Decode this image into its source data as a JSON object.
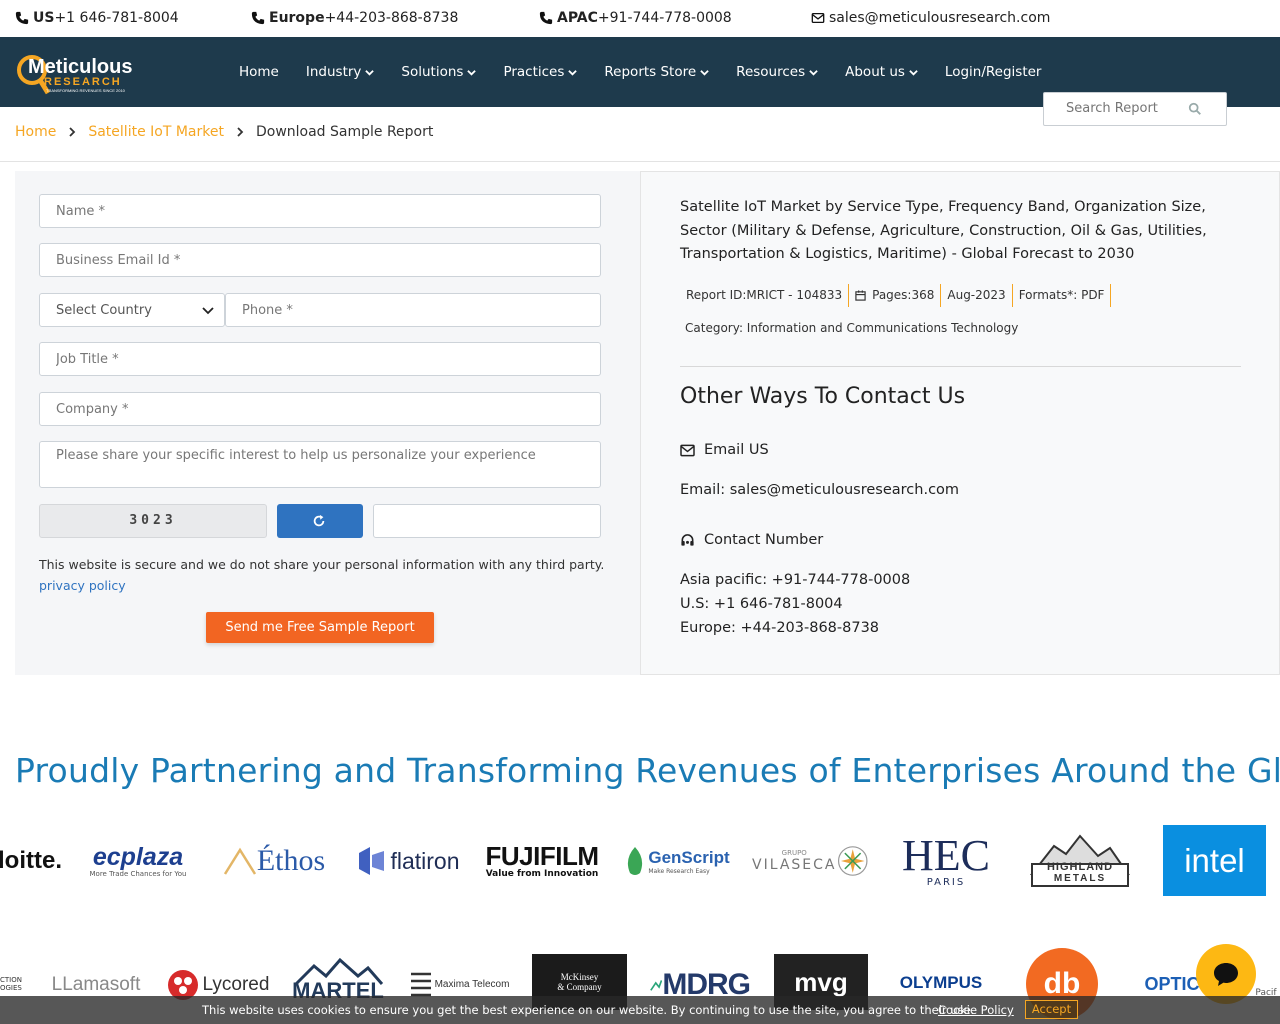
{
  "topbar": {
    "us_label": "US",
    "us_phone": "+1 646-781-8004",
    "europe_label": "Europe",
    "europe_phone": "+44-203-868-8738",
    "apac_label": "APAC",
    "apac_phone": "+91-744-778-0008",
    "email": "sales@meticulousresearch.com"
  },
  "brand": {
    "logo_name": "Meticulous",
    "logo_sub": "RESEARCH",
    "logo_tag": "TRANSFORMING REVENUES SINCE 2010",
    "colors": {
      "nav_bg": "#1e3a4c",
      "accent": "#f5a623",
      "cta": "#f26522",
      "link": "#2f73c0",
      "heading": "#1a7bb5"
    }
  },
  "nav": {
    "items": [
      {
        "label": "Home",
        "dropdown": false
      },
      {
        "label": "Industry",
        "dropdown": true
      },
      {
        "label": "Solutions",
        "dropdown": true
      },
      {
        "label": "Practices",
        "dropdown": true
      },
      {
        "label": "Reports Store",
        "dropdown": true
      },
      {
        "label": "Resources",
        "dropdown": true
      },
      {
        "label": "About us",
        "dropdown": true
      },
      {
        "label": "Login/Register",
        "dropdown": false
      }
    ],
    "search_placeholder": "Search Report"
  },
  "breadcrumb": {
    "home": "Home",
    "market": "Satellite IoT Market",
    "current": "Download Sample Report"
  },
  "form": {
    "name_placeholder": "Name *",
    "email_placeholder": "Business Email Id *",
    "country_selected": "Select Country",
    "phone_placeholder": "Phone *",
    "job_placeholder": "Job Title *",
    "company_placeholder": "Company *",
    "interest_placeholder": "Please share your specific interest to help us personalize your experience",
    "captcha_code": "3023",
    "captcha_value": "",
    "secure_note": "This website is secure and we do not share your personal information with any third party.",
    "privacy_label": "privacy policy",
    "submit_label": "Send me Free Sample Report"
  },
  "report": {
    "title": "Satellite IoT Market by Service Type, Frequency Band, Organization Size, Sector (Military & Defense, Agriculture, Construction, Oil & Gas, Utilities, Transportation & Logistics, Maritime) - Global Forecast to 2030",
    "report_id": "Report ID:MRICT - 104833",
    "pages": "Pages:368",
    "date": "Aug-2023",
    "formats": "Formats*: PDF",
    "category": "Category: Information and Communications Technology"
  },
  "contact": {
    "heading": "Other Ways To Contact Us",
    "email_heading": "Email US",
    "email_line": "Email: sales@meticulousresearch.com",
    "number_heading": "Contact Number",
    "asia": "Asia pacific: +91-744-778-0008",
    "us": "U.S: +1 646-781-8004",
    "europe": "Europe: +44-203-868-8738"
  },
  "partners": {
    "title": "Proudly Partnering and Transforming Revenues of Enterprises Around the Globe",
    "row1": [
      "loitte.",
      "ecplaza",
      "More Trade Chances for You",
      "Éthos",
      "flatiron",
      "FUJIFILM",
      "Value from Innovation",
      "GenScript",
      "Make Research Easy",
      "GRUPO",
      "VILASECA",
      "HEC",
      "PARIS",
      "HIGHLAND",
      "METALS",
      "intel"
    ],
    "row2": [
      "CTION",
      "OGIES",
      "LLamasoft",
      "Lycored",
      "MARTEL",
      "Maxima Telecom",
      "McKinsey",
      "& Company",
      "MDRG",
      "mvg",
      "OLYMPUS",
      "db",
      "OPTIC",
      "Pacif"
    ]
  },
  "cookie": {
    "text": "This website uses cookies to ensure you get the best experience on our website. By continuing to use the site, you agree to their use.",
    "link": "Cookie Policy",
    "accept": "Accept"
  }
}
